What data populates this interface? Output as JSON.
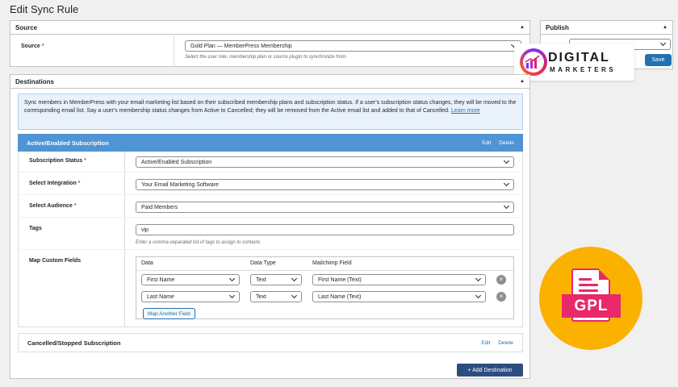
{
  "page": {
    "title": "Edit Sync Rule"
  },
  "source": {
    "header": "Source",
    "label": "Source",
    "selected": "Gold Plan — MemberPress Membership",
    "help": "Select the user role, membership plan or source plugin to synchronize from."
  },
  "publish": {
    "header": "Publish",
    "save_label": "Save"
  },
  "logo": {
    "line1": "DIGITAL",
    "line2": "MARKETERS"
  },
  "destinations": {
    "header": "Destinations",
    "info_text": "Sync members in MemberPress with your email marketing list based on their subscribed membership plans and subscription status. If a user's subscription status changes, they will be moved to the corresponding email list. Say a user's membership status changes from Active to Cancelled; they will be removed from the Active email list and added to that of Cancelled.",
    "info_link": "Learn more",
    "active": {
      "title": "Active/Enabled Subscription",
      "edit": "Edit",
      "delete": "Delete",
      "subscription_status": {
        "label": "Subscription Status",
        "value": "Active/Enabled Subscription"
      },
      "integration": {
        "label": "Select Integration",
        "value": "Your Email Marketing Software"
      },
      "audience": {
        "label": "Select Audience",
        "value": "Paid Members"
      },
      "tags": {
        "label": "Tags",
        "value": "vip",
        "help": "Enter a comma-separated list of tags to assign to contacts"
      },
      "custom_fields": {
        "label": "Map Custom Fields",
        "headers": [
          "Data",
          "Data Type",
          "Mailchimp Field"
        ],
        "rows": [
          {
            "data": "First Name",
            "type": "Text",
            "field": "First Name (Text)"
          },
          {
            "data": "Last Name",
            "type": "Text",
            "field": "Last Name (Text)"
          }
        ],
        "add_label": "Map Another Field"
      }
    },
    "cancelled": {
      "title": "Cancelled/Stopped Subscription",
      "edit": "Edit",
      "delete": "Delete"
    },
    "add_label": "+ Add Destination"
  },
  "gpl_badge": {
    "label": "GPL"
  },
  "colors": {
    "accent": "#2271b1",
    "header_blue": "#4f94d4",
    "gpl_yellow": "#fbb100",
    "gpl_pink": "#e8286b"
  }
}
